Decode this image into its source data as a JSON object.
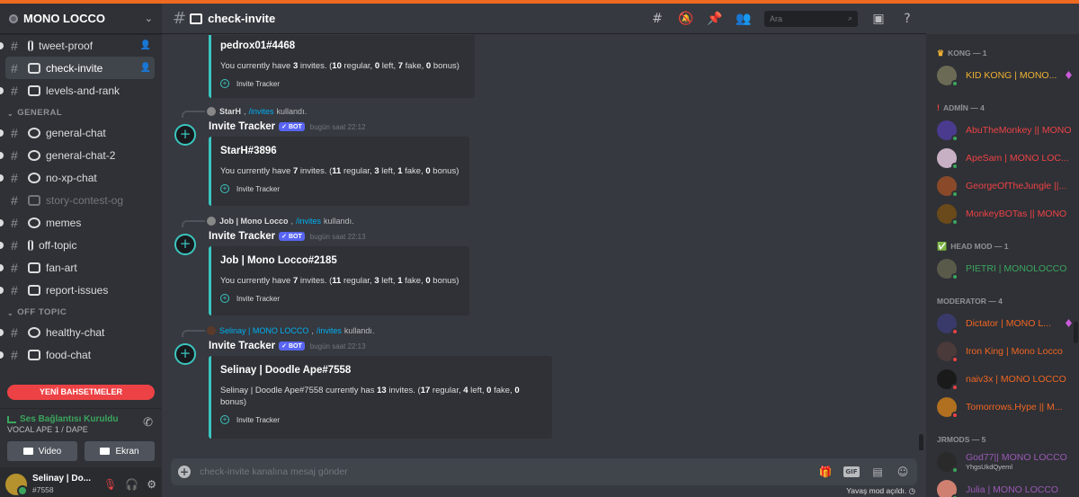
{
  "guild": {
    "name": "MONO LOCCO"
  },
  "channels": [
    {
      "name": "tweet-proof"
    },
    {
      "name": "check-invite"
    },
    {
      "name": "levels-and-rank"
    }
  ],
  "cat_general": "GENERAL",
  "general": [
    {
      "name": "general-chat"
    },
    {
      "name": "general-chat-2"
    },
    {
      "name": "no-xp-chat"
    },
    {
      "name": "story-contest-og"
    },
    {
      "name": "memes"
    },
    {
      "name": "off-topic"
    },
    {
      "name": "fan-art"
    },
    {
      "name": "report-issues"
    }
  ],
  "cat_offtopic": "OFF TOPIC",
  "offtopic": [
    {
      "name": "healthy-chat"
    },
    {
      "name": "food-chat"
    }
  ],
  "new_mentions": "YENİ BAHSETMELER",
  "voice": {
    "status": "Ses Bağlantısı Kuruldu",
    "channel": "VOCAL APE 1 / DAPE",
    "video": "Video",
    "screen": "Ekran"
  },
  "user": {
    "name": "Selinay | Do...",
    "tag": "#7558"
  },
  "header": {
    "channel": "check-invite",
    "search_placeholder": "Ara"
  },
  "messages": [
    {
      "embed_title": "pedrox01#4468",
      "desc": {
        "p1": "You currently have ",
        "n1": "3",
        "p2": " invites. (",
        "n2": "10",
        "p3": " regular, ",
        "n3": "0",
        "p4": " left, ",
        "n4": "7",
        "p5": " fake, ",
        "n5": "0",
        "p6": " bonus)"
      },
      "footer": "Invite Tracker"
    },
    {
      "reply_user": "StarH",
      "reply_sep": ",",
      "reply_cmd": "/invites",
      "reply_used": "kullandı.",
      "author": "Invite Tracker",
      "bot": "✓ BOT",
      "time": "bugün saat 22:12",
      "embed_title": "StarH#3896",
      "desc": {
        "p1": "You currently have ",
        "n1": "7",
        "p2": " invites. (",
        "n2": "11",
        "p3": " regular, ",
        "n3": "3",
        "p4": " left, ",
        "n4": "1",
        "p5": " fake, ",
        "n5": "0",
        "p6": " bonus)"
      },
      "footer": "Invite Tracker"
    },
    {
      "reply_user": "Job | Mono Locco",
      "reply_sep": ",",
      "reply_cmd": "/invites",
      "reply_used": "kullandı.",
      "author": "Invite Tracker",
      "bot": "✓ BOT",
      "time": "bugün saat 22:13",
      "embed_title": "Job | Mono Locco#2185",
      "desc": {
        "p1": "You currently have ",
        "n1": "7",
        "p2": " invites. (",
        "n2": "11",
        "p3": " regular, ",
        "n3": "3",
        "p4": " left, ",
        "n4": "1",
        "p5": " fake, ",
        "n5": "0",
        "p6": " bonus)"
      },
      "footer": "Invite Tracker"
    },
    {
      "reply_user": "Selinay | MONO LOCCO",
      "reply_sep": ",",
      "reply_cmd": "/invites",
      "reply_used": "kullandı.",
      "author": "Invite Tracker",
      "bot": "✓ BOT",
      "time": "bugün saat 22:13",
      "embed_title": "Selinay | Doodle Ape#7558",
      "desc": {
        "p1": "Selinay | Doodle Ape#7558 currently has ",
        "n1": "13",
        "p2": " invites. (",
        "n2": "17",
        "p3": " regular, ",
        "n3": "4",
        "p4": " left, ",
        "n4": "0",
        "p5": " fake, ",
        "n5": "0",
        "p6": " bonus)"
      },
      "footer": "Invite Tracker"
    }
  ],
  "composer": {
    "placeholder": "check-invite kanalına mesaj gönder"
  },
  "slowmode": "Yavaş mod açıldı.",
  "members": {
    "kong": {
      "title": "KONG — 1",
      "list": [
        {
          "name": "KID KONG | MONO...",
          "color": "#f0b232"
        }
      ]
    },
    "admin": {
      "title": "ADMİN — 4",
      "list": [
        {
          "name": "AbuTheMonkey || MONO",
          "color": "#ed4245"
        },
        {
          "name": "ApeSam | MONO LOC...",
          "color": "#ed4245"
        },
        {
          "name": "GeorgeOfTheJungle ||...",
          "color": "#ed4245"
        },
        {
          "name": "MonkeyBOTas || MONO",
          "color": "#ed4245"
        }
      ]
    },
    "headmod": {
      "title": "HEAD MOD — 1",
      "list": [
        {
          "name": "PIETRI | MONOLOCCO",
          "color": "#3ba55d"
        }
      ]
    },
    "moderator": {
      "title": "MODERATOR — 4",
      "list": [
        {
          "name": "Dictator | MONO L...",
          "color": "#f26522"
        },
        {
          "name": "Iron King | Mono Locco",
          "color": "#f26522"
        },
        {
          "name": "naiv3x | MONO LOCCO",
          "color": "#f26522"
        },
        {
          "name": "Tomorrows.Hype || M...",
          "color": "#f26522"
        }
      ]
    },
    "jrmods": {
      "title": "JRMODS — 5",
      "list": [
        {
          "name": "God77|| MONO LOCCO",
          "color": "#9b59b6",
          "sub": "YhgsUkdQyeml"
        },
        {
          "name": "Julia | MONO LOCCO",
          "color": "#9b59b6"
        }
      ]
    }
  },
  "colors": {
    "accent": "#ee6a21",
    "embed": "#3bc6c0",
    "bot": "#5865f2"
  }
}
